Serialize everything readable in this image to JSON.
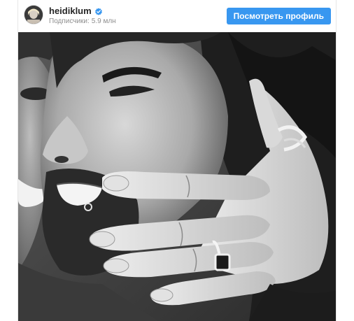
{
  "header": {
    "username": "heidiklum",
    "verified_icon": "verified-badge-icon",
    "followers_label": "Подписчики:",
    "followers_count": "5.9 млн",
    "view_profile_label": "Посмотреть профиль"
  },
  "photo": {
    "style": "black-and-white"
  },
  "colors": {
    "accent": "#3897f0",
    "text_primary": "#262626",
    "text_secondary": "#8e8e8e"
  }
}
